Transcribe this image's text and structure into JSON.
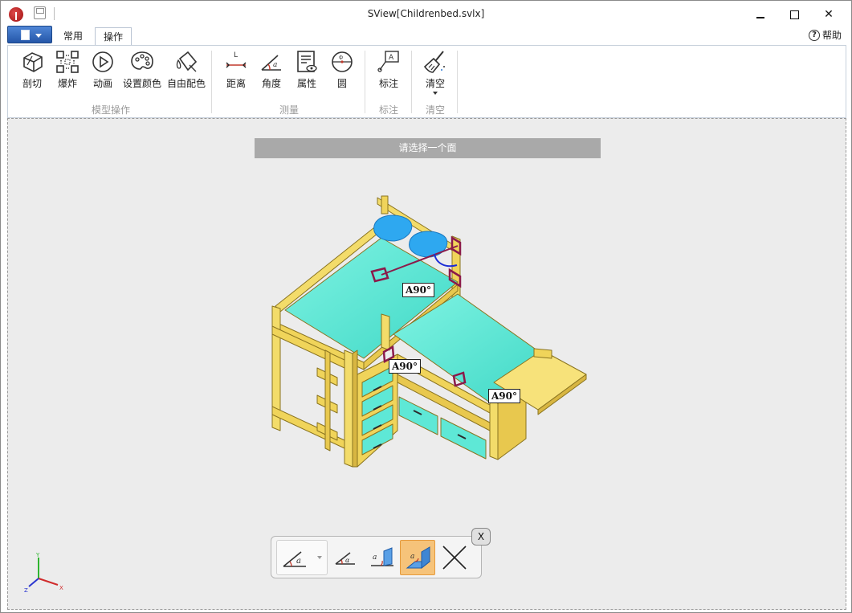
{
  "window": {
    "title": "SView[Childrenbed.svlx]",
    "minimize_glyph": "",
    "maximize_glyph": "",
    "close_glyph": "✕"
  },
  "tabs": {
    "common": "常用",
    "operate": "操作",
    "help": "帮助",
    "help_glyph": "?"
  },
  "ribbon": {
    "groups": [
      {
        "label": "模型操作",
        "tools": [
          "剖切",
          "爆炸",
          "动画",
          "设置颜色",
          "自由配色"
        ]
      },
      {
        "label": "测量",
        "tools": [
          "距离",
          "角度",
          "属性",
          "圆"
        ]
      },
      {
        "label": "标注",
        "tools": [
          "标注"
        ]
      },
      {
        "label": "清空",
        "tools": [
          "清空"
        ]
      }
    ]
  },
  "viewport": {
    "prompt": "请选择一个面",
    "angle_labels": [
      "A90°",
      "A90°",
      "A90°"
    ],
    "axis": {
      "x": "X",
      "y": "Y",
      "z": "Z"
    }
  },
  "float_toolbar": {
    "close_label": "X",
    "active_index": 3,
    "accent": "#f6c37a"
  },
  "colors": {
    "bed_frame": "#f0d45a",
    "bed_frame_edge": "#8a7420",
    "mattress": "#5ee8d6",
    "pillow": "#2ea8f0",
    "measure": "#8b1a4a"
  }
}
